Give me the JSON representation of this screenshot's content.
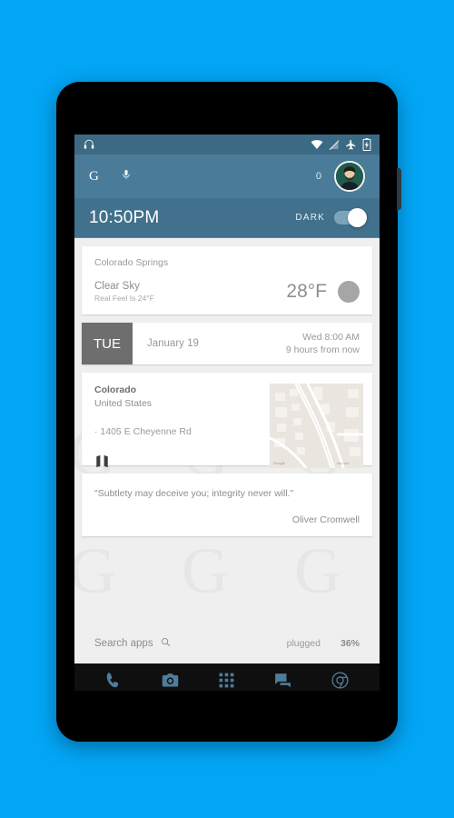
{
  "background_color": "#03a5f5",
  "status_bar": {
    "left_icons": [
      "headphones-icon"
    ],
    "right_icons": [
      "wifi-icon",
      "signal-off-icon",
      "airplane-mode-icon",
      "battery-charging-icon"
    ]
  },
  "search_row": {
    "google_logo": "G",
    "mic_icon": "microphone-icon",
    "notification_count": "0",
    "avatar": "user-avatar"
  },
  "time_row": {
    "clock": "10:50PM",
    "dark_label": "DARK",
    "dark_enabled": true
  },
  "cards": {
    "weather": {
      "city": "Colorado Springs",
      "condition": "Clear Sky",
      "real_feel": "Real Feel Is 24°F",
      "temperature": "28°F",
      "icon": "weather-sun-icon"
    },
    "calendar": {
      "day": "TUE",
      "date": "January 19",
      "event_time": "Wed 8:00 AM",
      "relative_time": "9 hours from now"
    },
    "location": {
      "region": "Colorado",
      "country": "United States",
      "address": "· 1405 E Cheyenne Rd",
      "map_icon": "map-icon",
      "map_thumbnail": "map-thumbnail"
    },
    "quote": {
      "text": "\"Subtlety may deceive you; integrity never will.\"",
      "author": "Oliver Cromwell"
    }
  },
  "apps_bar": {
    "search_label": "Search apps",
    "search_icon": "search-icon",
    "battery_state": "plugged",
    "battery_percent": "36%"
  },
  "dock": {
    "items": [
      {
        "name": "phone-icon",
        "label": "Phone"
      },
      {
        "name": "camera-icon",
        "label": "Camera"
      },
      {
        "name": "app-drawer-icon",
        "label": "Apps"
      },
      {
        "name": "messages-icon",
        "label": "Messages"
      },
      {
        "name": "chrome-icon",
        "label": "Chrome"
      }
    ],
    "icon_color": "#4e7c9b"
  },
  "nav_bar": {
    "back": "back-icon",
    "home": "home-icon",
    "recents": "recents-icon",
    "menu": "overflow-menu-icon"
  },
  "watermarks": [
    "G",
    "G",
    "G",
    "G",
    "G",
    "G"
  ]
}
